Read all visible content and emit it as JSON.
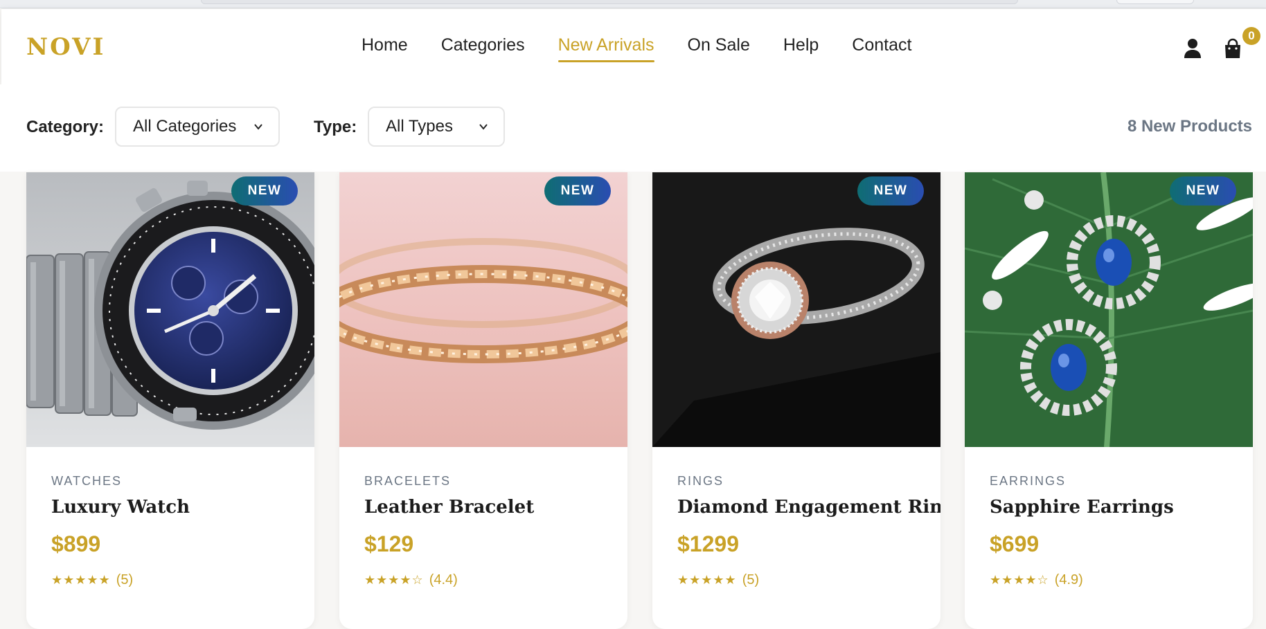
{
  "brand": {
    "logo": "NOVI",
    "accent": "#c9a227"
  },
  "nav": {
    "items": [
      {
        "label": "Home"
      },
      {
        "label": "Categories"
      },
      {
        "label": "New Arrivals",
        "active": true
      },
      {
        "label": "On Sale"
      },
      {
        "label": "Help"
      },
      {
        "label": "Contact"
      }
    ]
  },
  "header_icons": {
    "user": "user-icon",
    "cart": "shopping-bag-icon",
    "cart_count": "0"
  },
  "filters": {
    "category_label": "Category:",
    "category_value": "All Categories",
    "type_label": "Type:",
    "type_value": "All Types",
    "count_text": "8 New Products"
  },
  "products": [
    {
      "badge": "NEW",
      "category": "WATCHES",
      "name": "Luxury Watch",
      "price": "$899",
      "stars": "★★★★★",
      "rating": "(5)",
      "image": "luxury-watch-photo"
    },
    {
      "badge": "NEW",
      "category": "BRACELETS",
      "name": "Leather Bracelet",
      "price": "$129",
      "stars": "★★★★☆",
      "rating": "(4.4)",
      "image": "gold-bracelet-photo"
    },
    {
      "badge": "NEW",
      "category": "RINGS",
      "name": "Diamond Engagement Ring",
      "price": "$1299",
      "stars": "★★★★★",
      "rating": "(5)",
      "image": "diamond-ring-photo"
    },
    {
      "badge": "NEW",
      "category": "EARRINGS",
      "name": "Sapphire Earrings",
      "price": "$699",
      "stars": "★★★★☆",
      "rating": "(4.9)",
      "image": "sapphire-earrings-photo"
    }
  ],
  "colors": {
    "badge_gradient_start": "#0f6d73",
    "badge_gradient_end": "#2a4db1",
    "muted_text": "#6b7684"
  }
}
